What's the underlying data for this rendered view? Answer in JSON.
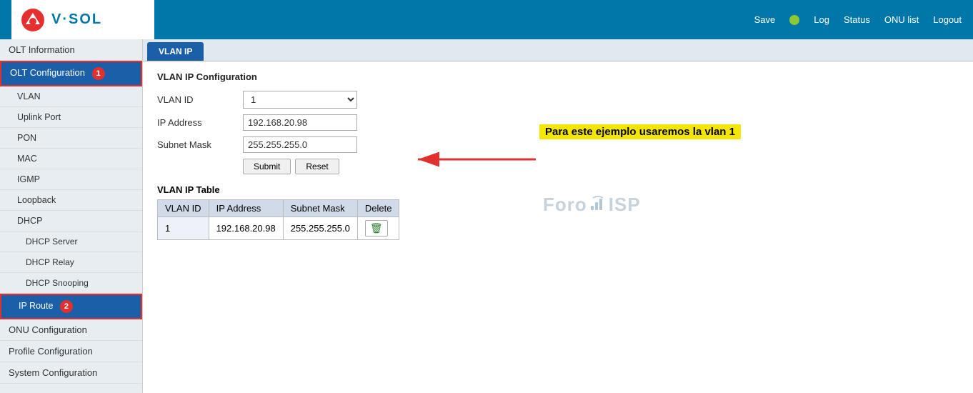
{
  "header": {
    "logo_brand": "V·SOL",
    "save_label": "Save",
    "log_label": "Log",
    "status_label": "Status",
    "onu_list_label": "ONU list",
    "logout_label": "Logout"
  },
  "sidebar": {
    "items": [
      {
        "id": "olt-information",
        "label": "OLT Information",
        "level": 0,
        "active": false,
        "highlighted": false
      },
      {
        "id": "olt-configuration",
        "label": "OLT Configuration",
        "level": 0,
        "active": true,
        "highlighted": false,
        "badge": "1"
      },
      {
        "id": "vlan",
        "label": "VLAN",
        "level": 1,
        "active": false
      },
      {
        "id": "uplink-port",
        "label": "Uplink Port",
        "level": 1,
        "active": false
      },
      {
        "id": "pon",
        "label": "PON",
        "level": 1,
        "active": false
      },
      {
        "id": "mac",
        "label": "MAC",
        "level": 1,
        "active": false
      },
      {
        "id": "igmp",
        "label": "IGMP",
        "level": 1,
        "active": false
      },
      {
        "id": "loopback",
        "label": "Loopback",
        "level": 1,
        "active": false
      },
      {
        "id": "dhcp",
        "label": "DHCP",
        "level": 1,
        "active": false
      },
      {
        "id": "dhcp-server",
        "label": "DHCP Server",
        "level": 2,
        "active": false
      },
      {
        "id": "dhcp-relay",
        "label": "DHCP Relay",
        "level": 2,
        "active": false
      },
      {
        "id": "dhcp-snooping",
        "label": "DHCP Snooping",
        "level": 2,
        "active": false
      },
      {
        "id": "ip-route",
        "label": "IP Route",
        "level": 1,
        "active": false,
        "highlighted": true,
        "badge": "2"
      },
      {
        "id": "onu-configuration",
        "label": "ONU Configuration",
        "level": 0,
        "active": false
      },
      {
        "id": "profile-configuration",
        "label": "Profile Configuration",
        "level": 0,
        "active": false
      },
      {
        "id": "system-configuration",
        "label": "System Configuration",
        "level": 0,
        "active": false
      }
    ]
  },
  "tab": {
    "label": "VLAN IP"
  },
  "main": {
    "section_title": "VLAN IP Configuration",
    "callout_text": "Para este ejemplo usaremos la vlan 1",
    "form": {
      "vlan_id_label": "VLAN ID",
      "vlan_id_value": "1",
      "ip_address_label": "IP Address",
      "ip_address_value": "192.168.20.98",
      "subnet_mask_label": "Subnet Mask",
      "subnet_mask_value": "255.255.255.0",
      "submit_label": "Submit",
      "reset_label": "Reset"
    },
    "table": {
      "title": "VLAN IP Table",
      "columns": [
        "VLAN ID",
        "IP Address",
        "Subnet Mask",
        "Delete"
      ],
      "rows": [
        {
          "vlan_id": "1",
          "ip_address": "192.168.20.98",
          "subnet_mask": "255.255.255.0"
        }
      ]
    }
  }
}
